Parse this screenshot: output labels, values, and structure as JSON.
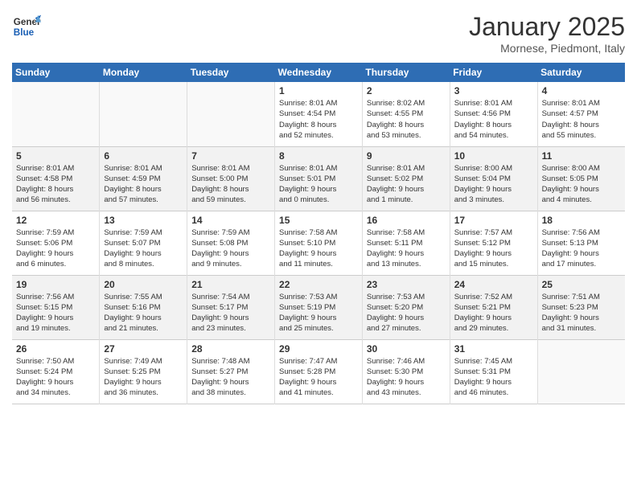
{
  "logo": {
    "line1": "General",
    "line2": "Blue"
  },
  "title": "January 2025",
  "location": "Mornese, Piedmont, Italy",
  "weekdays": [
    "Sunday",
    "Monday",
    "Tuesday",
    "Wednesday",
    "Thursday",
    "Friday",
    "Saturday"
  ],
  "weeks": [
    [
      {
        "day": "",
        "info": ""
      },
      {
        "day": "",
        "info": ""
      },
      {
        "day": "",
        "info": ""
      },
      {
        "day": "1",
        "info": "Sunrise: 8:01 AM\nSunset: 4:54 PM\nDaylight: 8 hours\nand 52 minutes."
      },
      {
        "day": "2",
        "info": "Sunrise: 8:02 AM\nSunset: 4:55 PM\nDaylight: 8 hours\nand 53 minutes."
      },
      {
        "day": "3",
        "info": "Sunrise: 8:01 AM\nSunset: 4:56 PM\nDaylight: 8 hours\nand 54 minutes."
      },
      {
        "day": "4",
        "info": "Sunrise: 8:01 AM\nSunset: 4:57 PM\nDaylight: 8 hours\nand 55 minutes."
      }
    ],
    [
      {
        "day": "5",
        "info": "Sunrise: 8:01 AM\nSunset: 4:58 PM\nDaylight: 8 hours\nand 56 minutes."
      },
      {
        "day": "6",
        "info": "Sunrise: 8:01 AM\nSunset: 4:59 PM\nDaylight: 8 hours\nand 57 minutes."
      },
      {
        "day": "7",
        "info": "Sunrise: 8:01 AM\nSunset: 5:00 PM\nDaylight: 8 hours\nand 59 minutes."
      },
      {
        "day": "8",
        "info": "Sunrise: 8:01 AM\nSunset: 5:01 PM\nDaylight: 9 hours\nand 0 minutes."
      },
      {
        "day": "9",
        "info": "Sunrise: 8:01 AM\nSunset: 5:02 PM\nDaylight: 9 hours\nand 1 minute."
      },
      {
        "day": "10",
        "info": "Sunrise: 8:00 AM\nSunset: 5:04 PM\nDaylight: 9 hours\nand 3 minutes."
      },
      {
        "day": "11",
        "info": "Sunrise: 8:00 AM\nSunset: 5:05 PM\nDaylight: 9 hours\nand 4 minutes."
      }
    ],
    [
      {
        "day": "12",
        "info": "Sunrise: 7:59 AM\nSunset: 5:06 PM\nDaylight: 9 hours\nand 6 minutes."
      },
      {
        "day": "13",
        "info": "Sunrise: 7:59 AM\nSunset: 5:07 PM\nDaylight: 9 hours\nand 8 minutes."
      },
      {
        "day": "14",
        "info": "Sunrise: 7:59 AM\nSunset: 5:08 PM\nDaylight: 9 hours\nand 9 minutes."
      },
      {
        "day": "15",
        "info": "Sunrise: 7:58 AM\nSunset: 5:10 PM\nDaylight: 9 hours\nand 11 minutes."
      },
      {
        "day": "16",
        "info": "Sunrise: 7:58 AM\nSunset: 5:11 PM\nDaylight: 9 hours\nand 13 minutes."
      },
      {
        "day": "17",
        "info": "Sunrise: 7:57 AM\nSunset: 5:12 PM\nDaylight: 9 hours\nand 15 minutes."
      },
      {
        "day": "18",
        "info": "Sunrise: 7:56 AM\nSunset: 5:13 PM\nDaylight: 9 hours\nand 17 minutes."
      }
    ],
    [
      {
        "day": "19",
        "info": "Sunrise: 7:56 AM\nSunset: 5:15 PM\nDaylight: 9 hours\nand 19 minutes."
      },
      {
        "day": "20",
        "info": "Sunrise: 7:55 AM\nSunset: 5:16 PM\nDaylight: 9 hours\nand 21 minutes."
      },
      {
        "day": "21",
        "info": "Sunrise: 7:54 AM\nSunset: 5:17 PM\nDaylight: 9 hours\nand 23 minutes."
      },
      {
        "day": "22",
        "info": "Sunrise: 7:53 AM\nSunset: 5:19 PM\nDaylight: 9 hours\nand 25 minutes."
      },
      {
        "day": "23",
        "info": "Sunrise: 7:53 AM\nSunset: 5:20 PM\nDaylight: 9 hours\nand 27 minutes."
      },
      {
        "day": "24",
        "info": "Sunrise: 7:52 AM\nSunset: 5:21 PM\nDaylight: 9 hours\nand 29 minutes."
      },
      {
        "day": "25",
        "info": "Sunrise: 7:51 AM\nSunset: 5:23 PM\nDaylight: 9 hours\nand 31 minutes."
      }
    ],
    [
      {
        "day": "26",
        "info": "Sunrise: 7:50 AM\nSunset: 5:24 PM\nDaylight: 9 hours\nand 34 minutes."
      },
      {
        "day": "27",
        "info": "Sunrise: 7:49 AM\nSunset: 5:25 PM\nDaylight: 9 hours\nand 36 minutes."
      },
      {
        "day": "28",
        "info": "Sunrise: 7:48 AM\nSunset: 5:27 PM\nDaylight: 9 hours\nand 38 minutes."
      },
      {
        "day": "29",
        "info": "Sunrise: 7:47 AM\nSunset: 5:28 PM\nDaylight: 9 hours\nand 41 minutes."
      },
      {
        "day": "30",
        "info": "Sunrise: 7:46 AM\nSunset: 5:30 PM\nDaylight: 9 hours\nand 43 minutes."
      },
      {
        "day": "31",
        "info": "Sunrise: 7:45 AM\nSunset: 5:31 PM\nDaylight: 9 hours\nand 46 minutes."
      },
      {
        "day": "",
        "info": ""
      }
    ]
  ]
}
